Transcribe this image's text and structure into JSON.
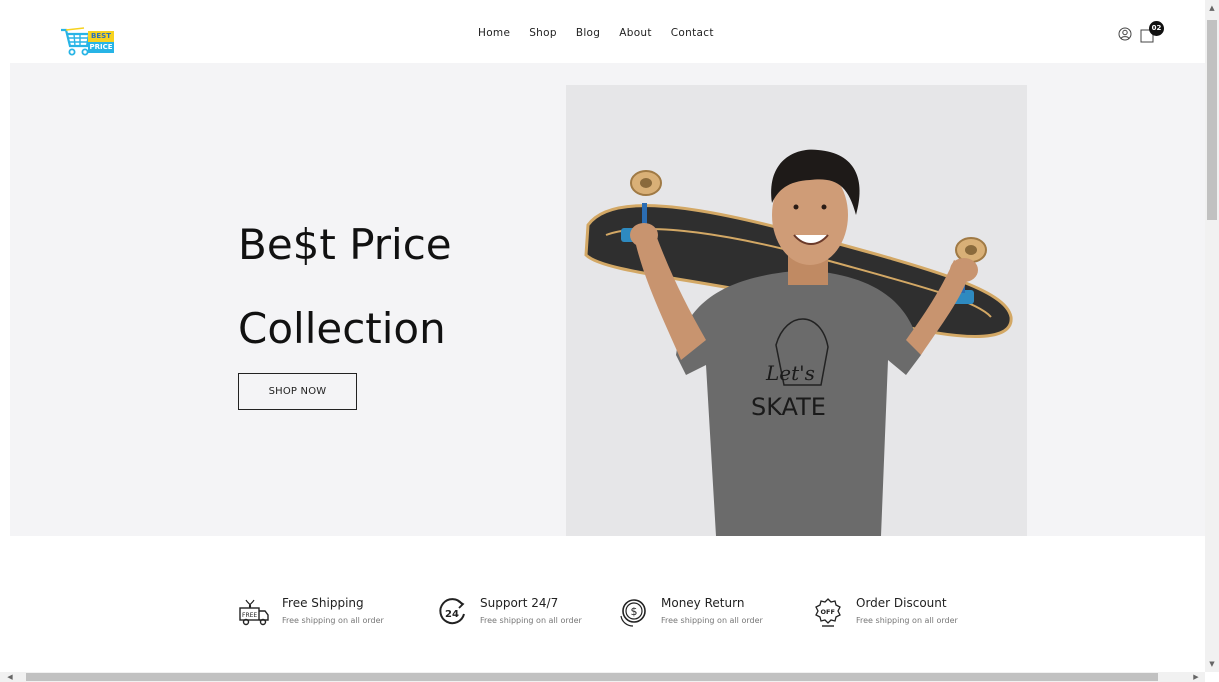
{
  "logo": {
    "line1": "BEST",
    "line2": "PRICE"
  },
  "nav": {
    "items": [
      "Home",
      "Shop",
      "Blog",
      "About",
      "Contact"
    ]
  },
  "header": {
    "cart_count": "02"
  },
  "hero": {
    "title_line1": "Be$t Price",
    "title_line2": "Collection",
    "button_label": "SHOP NOW",
    "shirt_text_1": "Let's",
    "shirt_text_2": "SKATE"
  },
  "features": [
    {
      "title": "Free Shipping",
      "desc": "Free shipping on all order",
      "icon": "truck-icon",
      "icon_text": "FREE"
    },
    {
      "title": "Support 24/7",
      "desc": "Free shipping on all order",
      "icon": "clock-24-icon",
      "icon_text": "24"
    },
    {
      "title": "Money Return",
      "desc": "Free shipping on all order",
      "icon": "money-return-icon"
    },
    {
      "title": "Order Discount",
      "desc": "Free shipping on all order",
      "icon": "discount-badge-icon",
      "icon_text": "OFF"
    }
  ],
  "colors": {
    "hero_bg": "#f4f4f6",
    "accent_yellow": "#f6d21f",
    "accent_blue": "#27b4e6",
    "text": "#111111"
  }
}
